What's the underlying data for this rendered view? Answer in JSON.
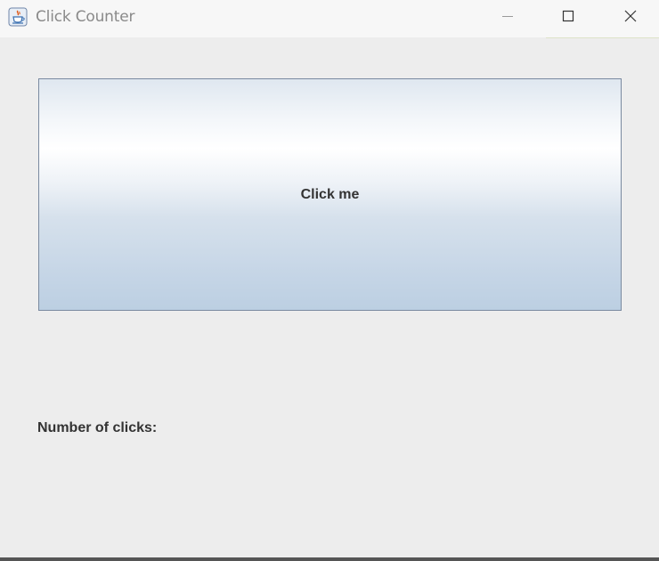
{
  "window": {
    "title": "Click Counter",
    "icon": "java-cup-icon",
    "controls": [
      "minimize-icon",
      "maximize-icon",
      "close-icon"
    ]
  },
  "main": {
    "button_label": "Click me",
    "clicks_label": "Number of clicks:"
  },
  "colors": {
    "background": "#ededed",
    "button_border": "#7a8aa0",
    "button_gradient_top": "#dfe7f0",
    "button_gradient_bottom": "#bccfe2",
    "text": "#333333"
  }
}
